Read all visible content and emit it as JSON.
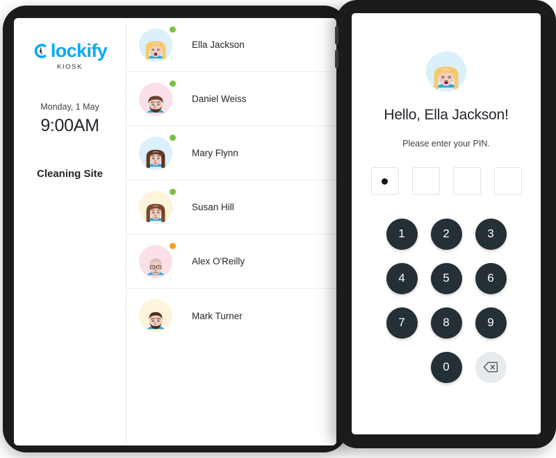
{
  "brand": {
    "name": "lockify",
    "logo_icon": "clockify-c-clock-icon",
    "subtitle": "KIOSK",
    "color": "#03a9f4"
  },
  "clock": {
    "date": "Monday, 1 May",
    "time": "9:00AM",
    "site": "Cleaning Site"
  },
  "users": [
    {
      "name": "Ella Jackson",
      "status": "online",
      "status_color": "#7cc043",
      "avatar_bg": "#dcf0fb",
      "hair": "#f6c96a",
      "hair_dark": "#e0a83c",
      "skin": "#f6ccc0",
      "shirt": "#2aa7dd",
      "avatar_style": "long-blonde"
    },
    {
      "name": "Daniel Weiss",
      "status": "online",
      "status_color": "#7cc043",
      "avatar_bg": "#fbe0ea",
      "hair": "#6b4630",
      "hair_dark": "#4e3222",
      "skin": "#f6ccc0",
      "shirt": "#2aa7dd",
      "avatar_style": "beard"
    },
    {
      "name": "Mary Flynn",
      "status": "online",
      "status_color": "#7cc043",
      "avatar_bg": "#dcf0fb",
      "hair": "#5c3a24",
      "hair_dark": "#432817",
      "skin": "#f6ccc0",
      "shirt": "#2aa7dd",
      "avatar_style": "long-brown"
    },
    {
      "name": "Susan Hill",
      "status": "online",
      "status_color": "#7cc043",
      "avatar_bg": "#fdf4dc",
      "hair": "#7a4a2c",
      "hair_dark": "#5a351d",
      "skin": "#f6ccc0",
      "shirt": "#2aa7dd",
      "avatar_style": "long-brown"
    },
    {
      "name": "Alex O'Reilly",
      "status": "away",
      "status_color": "#f99d1c",
      "avatar_bg": "#fbe0ea",
      "hair": "#d9c3b4",
      "hair_dark": "#bfa897",
      "skin": "#f6ccc0",
      "shirt": "#2aa7dd",
      "avatar_style": "bald-glasses"
    },
    {
      "name": "Mark Turner",
      "status": "offline",
      "status_color": "",
      "avatar_bg": "#fdf4dc",
      "hair": "#4b3322",
      "hair_dark": "#35220f",
      "skin": "#f6ccc0",
      "shirt": "#2aa7dd",
      "avatar_style": "short-beard"
    }
  ],
  "pin_panel": {
    "greeting": "Hello, Ella Jackson!",
    "prompt": "Please enter your PIN.",
    "avatar_bg": "#dcf0fb",
    "pin_length": 4,
    "pin_filled": 1,
    "keys": [
      "1",
      "2",
      "3",
      "4",
      "5",
      "6",
      "7",
      "8",
      "9"
    ],
    "zero_key": "0",
    "backspace_icon": "backspace-icon",
    "key_color": "#242f36",
    "backspace_bg": "#e7ebed"
  }
}
